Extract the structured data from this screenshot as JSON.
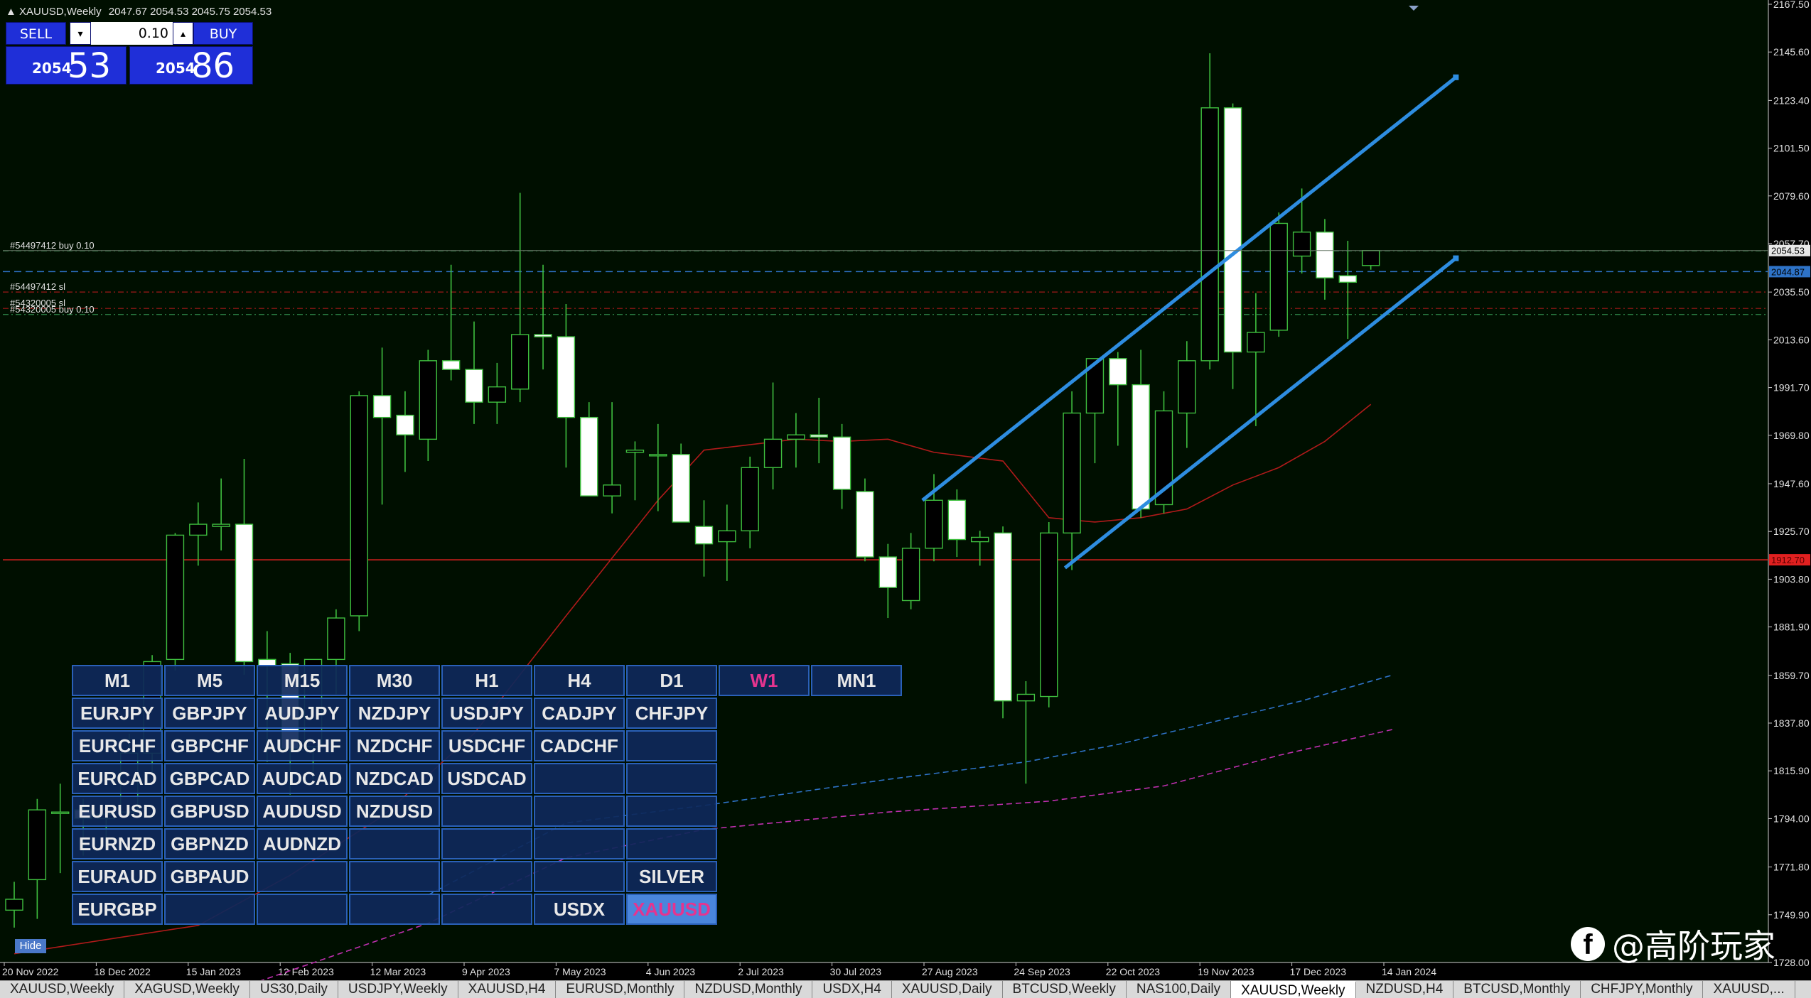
{
  "window": {
    "title": "XAUUSD,Weekly",
    "ohlc": "2047.67 2054.53 2045.75 2054.53"
  },
  "trade_panel": {
    "sell_label": "SELL",
    "buy_label": "BUY",
    "lot": "0.10",
    "bid_prefix": "2054",
    "bid_pips": "53",
    "ask_prefix": "2054",
    "ask_pips": "86",
    "down_glyph": "▾",
    "up_glyph": "▴"
  },
  "price_axis": {
    "ticks": [
      "2167.50",
      "2145.60",
      "2123.40",
      "2101.50",
      "2079.60",
      "2057.70",
      "2035.50",
      "2013.60",
      "1991.70",
      "1969.80",
      "1947.60",
      "1925.70",
      "1903.80",
      "1881.90",
      "1859.70",
      "1837.80",
      "1815.90",
      "1794.00",
      "1771.80",
      "1749.90",
      "1728.00"
    ],
    "current_price_label": "2054.53",
    "ask_line_label": "2044.87",
    "horizontal_line_label": "1912.70"
  },
  "time_axis": {
    "labels": [
      "20 Nov 2022",
      "18 Dec 2022",
      "15 Jan 2023",
      "12 Feb 2023",
      "12 Mar 2023",
      "9 Apr 2023",
      "7 May 2023",
      "4 Jun 2023",
      "2 Jul 2023",
      "30 Jul 2023",
      "27 Aug 2023",
      "24 Sep 2023",
      "22 Oct 2023",
      "19 Nov 2023",
      "17 Dec 2023",
      "14 Jan 2024"
    ]
  },
  "order_lines": [
    {
      "label": "#54497412 buy 0.10",
      "price": 2054.4,
      "color": "#2f8a4a"
    },
    {
      "label": "#54497412 sl",
      "price": 2035.5,
      "color": "#a01818"
    },
    {
      "label": "#54320005 sl",
      "price": 2028.0,
      "color": "#a01818"
    },
    {
      "label": "#54320005 buy 0.10",
      "price": 2025.2,
      "color": "#2f8a4a"
    }
  ],
  "levels": {
    "ask_price": 2044.87,
    "horizontal_line": 1912.7
  },
  "colors": {
    "background": "#000f00",
    "grid": "#0d2a0d",
    "candle_up": "#000000",
    "candle_down": "#ffffff",
    "wick": "#3fbf3f",
    "channel": "#2e8de0",
    "ma_red": "#b01a1a",
    "ma_blue": "#2e73c8",
    "ma_magenta": "#c02fb0",
    "axis_text": "#e0e0e0",
    "current_price_bg": "#e8e8e8",
    "ask_label_bg": "#2e73c8",
    "hline": "#e02020",
    "hline_label_bg": "#e02020"
  },
  "chart_data": {
    "type": "candlestick",
    "symbol": "XAUUSD",
    "timeframe": "Weekly",
    "ylim": [
      1728.0,
      2167.5
    ],
    "candles": [
      {
        "o": 1752,
        "h": 1765,
        "l": 1744,
        "c": 1757
      },
      {
        "o": 1766,
        "h": 1803,
        "l": 1748,
        "c": 1798
      },
      {
        "o": 1797,
        "h": 1810,
        "l": 1769,
        "c": 1797
      },
      {
        "o": 1798,
        "h": 1803,
        "l": 1777,
        "c": 1794
      },
      {
        "o": 1794,
        "h": 1800,
        "l": 1780,
        "c": 1796
      },
      {
        "o": 1797,
        "h": 1833,
        "l": 1796,
        "c": 1824
      },
      {
        "o": 1824,
        "h": 1869,
        "l": 1815,
        "c": 1866
      },
      {
        "o": 1867,
        "h": 1925,
        "l": 1862,
        "c": 1924
      },
      {
        "o": 1924,
        "h": 1939,
        "l": 1910,
        "c": 1929
      },
      {
        "o": 1928,
        "h": 1950,
        "l": 1917,
        "c": 1929
      },
      {
        "o": 1929,
        "h": 1959,
        "l": 1860,
        "c": 1866
      },
      {
        "o": 1867,
        "h": 1880,
        "l": 1820,
        "c": 1864
      },
      {
        "o": 1865,
        "h": 1870,
        "l": 1805,
        "c": 1826
      },
      {
        "o": 1827,
        "h": 1867,
        "l": 1812,
        "c": 1867
      },
      {
        "o": 1867,
        "h": 1890,
        "l": 1851,
        "c": 1886
      },
      {
        "o": 1887,
        "h": 1990,
        "l": 1880,
        "c": 1988
      },
      {
        "o": 1988,
        "h": 2010,
        "l": 1938,
        "c": 1978
      },
      {
        "o": 1979,
        "h": 1990,
        "l": 1953,
        "c": 1970
      },
      {
        "o": 1968,
        "h": 2009,
        "l": 1958,
        "c": 2004
      },
      {
        "o": 2004,
        "h": 2048,
        "l": 1995,
        "c": 2000
      },
      {
        "o": 2000,
        "h": 2022,
        "l": 1975,
        "c": 1985
      },
      {
        "o": 1985,
        "h": 2003,
        "l": 1975,
        "c": 1992
      },
      {
        "o": 1991,
        "h": 2081,
        "l": 1985,
        "c": 2016
      },
      {
        "o": 2016,
        "h": 2048,
        "l": 2000,
        "c": 2015
      },
      {
        "o": 2015,
        "h": 2030,
        "l": 1955,
        "c": 1978
      },
      {
        "o": 1978,
        "h": 1985,
        "l": 1945,
        "c": 1942
      },
      {
        "o": 1942,
        "h": 1985,
        "l": 1934,
        "c": 1947
      },
      {
        "o": 1962,
        "h": 1967,
        "l": 1940,
        "c": 1963
      },
      {
        "o": 1961,
        "h": 1975,
        "l": 1935,
        "c": 1961
      },
      {
        "o": 1961,
        "h": 1966,
        "l": 1931,
        "c": 1930
      },
      {
        "o": 1928,
        "h": 1940,
        "l": 1905,
        "c": 1920
      },
      {
        "o": 1921,
        "h": 1938,
        "l": 1903,
        "c": 1926
      },
      {
        "o": 1926,
        "h": 1960,
        "l": 1918,
        "c": 1955
      },
      {
        "o": 1955,
        "h": 1994,
        "l": 1945,
        "c": 1968
      },
      {
        "o": 1968,
        "h": 1980,
        "l": 1955,
        "c": 1970
      },
      {
        "o": 1970,
        "h": 1987,
        "l": 1957,
        "c": 1969
      },
      {
        "o": 1969,
        "h": 1975,
        "l": 1936,
        "c": 1945
      },
      {
        "o": 1944,
        "h": 1950,
        "l": 1912,
        "c": 1914
      },
      {
        "o": 1914,
        "h": 1920,
        "l": 1886,
        "c": 1900
      },
      {
        "o": 1894,
        "h": 1925,
        "l": 1890,
        "c": 1918
      },
      {
        "o": 1918,
        "h": 1952,
        "l": 1912,
        "c": 1940
      },
      {
        "o": 1940,
        "h": 1945,
        "l": 1914,
        "c": 1922
      },
      {
        "o": 1921,
        "h": 1926,
        "l": 1910,
        "c": 1923
      },
      {
        "o": 1925,
        "h": 1928,
        "l": 1840,
        "c": 1848
      },
      {
        "o": 1848,
        "h": 1857,
        "l": 1810,
        "c": 1851
      },
      {
        "o": 1850,
        "h": 1930,
        "l": 1845,
        "c": 1925
      },
      {
        "o": 1925,
        "h": 1990,
        "l": 1908,
        "c": 1980
      },
      {
        "o": 1980,
        "h": 2000,
        "l": 1957,
        "c": 2005
      },
      {
        "o": 2005,
        "h": 2008,
        "l": 1965,
        "c": 1993
      },
      {
        "o": 1993,
        "h": 2009,
        "l": 1932,
        "c": 1936
      },
      {
        "o": 1938,
        "h": 1990,
        "l": 1934,
        "c": 1981
      },
      {
        "o": 1980,
        "h": 2013,
        "l": 1964,
        "c": 2004
      },
      {
        "o": 2004,
        "h": 2145,
        "l": 2000,
        "c": 2120
      },
      {
        "o": 2120,
        "h": 2122,
        "l": 1991,
        "c": 2008
      },
      {
        "o": 2008,
        "h": 2035,
        "l": 1974,
        "c": 2017
      },
      {
        "o": 2018,
        "h": 2072,
        "l": 2015,
        "c": 2067
      },
      {
        "o": 2052,
        "h": 2083,
        "l": 2044,
        "c": 2063
      },
      {
        "o": 2063,
        "h": 2069,
        "l": 2032,
        "c": 2042
      },
      {
        "o": 2043,
        "h": 2059,
        "l": 2014,
        "c": 2040
      },
      {
        "o": 2047.67,
        "h": 2054.53,
        "l": 2045.75,
        "c": 2054.53
      }
    ],
    "moving_averages": [
      {
        "style": "solid",
        "color": "#b01a1a",
        "points": [
          [
            0,
            1732
          ],
          [
            8,
            1745
          ],
          [
            12,
            1768
          ],
          [
            16,
            1795
          ],
          [
            20,
            1833
          ],
          [
            24,
            1887
          ],
          [
            28,
            1940
          ],
          [
            30,
            1963
          ],
          [
            34,
            1968
          ],
          [
            36,
            1967
          ],
          [
            38,
            1968
          ],
          [
            40,
            1962
          ],
          [
            43,
            1958
          ],
          [
            45,
            1932
          ],
          [
            47,
            1930
          ],
          [
            49,
            1932
          ],
          [
            51,
            1936
          ],
          [
            53,
            1947
          ],
          [
            55,
            1955
          ],
          [
            57,
            1967
          ],
          [
            59,
            1984
          ]
        ]
      },
      {
        "style": "dashed",
        "color": "#2e73c8",
        "points": [
          [
            18,
            1759
          ],
          [
            24,
            1792
          ],
          [
            30,
            1800
          ],
          [
            38,
            1812
          ],
          [
            44,
            1820
          ],
          [
            48,
            1828
          ],
          [
            52,
            1838
          ],
          [
            56,
            1848
          ],
          [
            60,
            1860
          ]
        ]
      },
      {
        "style": "dashed",
        "color": "#c02fb0",
        "points": [
          [
            0,
            1697
          ],
          [
            10,
            1717
          ],
          [
            18,
            1746
          ],
          [
            24,
            1776
          ],
          [
            30,
            1789
          ],
          [
            38,
            1797
          ],
          [
            45,
            1802
          ],
          [
            50,
            1809
          ],
          [
            55,
            1823
          ],
          [
            60,
            1835
          ]
        ]
      }
    ],
    "trendlines": [
      {
        "from": [
          39.5,
          1940
        ],
        "to": [
          62.7,
          2134
        ],
        "color": "#2e8de0"
      },
      {
        "from": [
          45.7,
          1909
        ],
        "to": [
          62.7,
          2051
        ],
        "color": "#2e8de0"
      }
    ]
  },
  "timeframes": [
    "M1",
    "M5",
    "M15",
    "M30",
    "H1",
    "H4",
    "D1",
    "W1",
    "MN1"
  ],
  "active_timeframe": "W1",
  "symbol_grid": [
    [
      "EURJPY",
      "GBPJPY",
      "AUDJPY",
      "NZDJPY",
      "USDJPY",
      "CADJPY",
      "CHFJPY"
    ],
    [
      "EURCHF",
      "GBPCHF",
      "AUDCHF",
      "NZDCHF",
      "USDCHF",
      "CADCHF",
      ""
    ],
    [
      "EURCAD",
      "GBPCAD",
      "AUDCAD",
      "NZDCAD",
      "USDCAD",
      "",
      ""
    ],
    [
      "EURUSD",
      "GBPUSD",
      "AUDUSD",
      "NZDUSD",
      "",
      "",
      ""
    ],
    [
      "EURNZD",
      "GBPNZD",
      "AUDNZD",
      "",
      "",
      "",
      ""
    ],
    [
      "EURAUD",
      "GBPAUD",
      "",
      "",
      "",
      "",
      "SILVER"
    ],
    [
      "EURGBP",
      "",
      "",
      "",
      "",
      "USDX",
      "XAUUSD"
    ]
  ],
  "active_symbol": "XAUUSD",
  "hide_button": "Hide",
  "tabs": [
    "XAUUSD,Weekly",
    "XAGUSD,Weekly",
    "US30,Daily",
    "USDJPY,Weekly",
    "XAUUSD,H4",
    "EURUSD,Monthly",
    "NZDUSD,Monthly",
    "USDX,H4",
    "XAUUSD,Daily",
    "BTCUSD,Weekly",
    "NAS100,Daily",
    "XAUUSD,Weekly",
    "NZDUSD,H4",
    "BTCUSD,Monthly",
    "CHFJPY,Monthly",
    "XAUUSD,..."
  ],
  "active_tab_index": 11,
  "watermark": {
    "icon": "facebook-icon",
    "icon_glyph": "f",
    "text": "@高阶玩家"
  }
}
